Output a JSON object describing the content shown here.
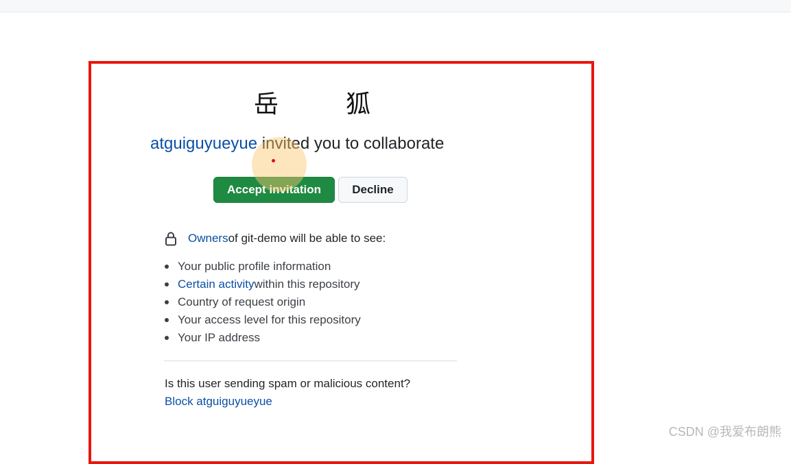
{
  "header": {
    "avatar_text": [
      "岳",
      "狐"
    ],
    "inviter": "atguiguyueyue",
    "headline_rest": " invited you to collaborate"
  },
  "actions": {
    "accept_label": "Accept invitation",
    "decline_label": "Decline"
  },
  "permissions": {
    "owners_link": "Owners",
    "intro_rest": " of git-demo will be able to see:",
    "items": [
      {
        "link": "",
        "text": "Your public profile information"
      },
      {
        "link": "Certain activity",
        "text": " within this repository"
      },
      {
        "link": "",
        "text": "Country of request origin"
      },
      {
        "link": "",
        "text": "Your access level for this repository"
      },
      {
        "link": "",
        "text": "Your IP address"
      }
    ]
  },
  "spam": {
    "question": "Is this user sending spam or malicious content?",
    "block_label": "Block atguiguyueyue"
  },
  "watermark": "CSDN @我爱布朗熊",
  "colors": {
    "accent_link": "#0a4fa6",
    "accept_green": "#1f8a42",
    "highlight_frame": "#e8160c"
  },
  "icons": {
    "lock": "lock-icon"
  }
}
